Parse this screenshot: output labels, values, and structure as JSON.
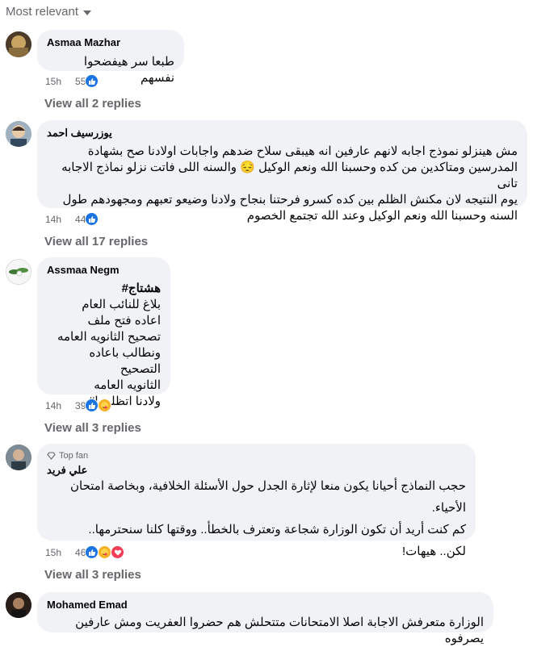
{
  "sort_label": "Most relevant",
  "comments": [
    {
      "author": "Asmaa Mazhar",
      "lines": [
        "طبعا سر هيفضحوا نفسهم"
      ],
      "time": "15h",
      "reactions": "55",
      "view_replies": "View all 2 replies"
    },
    {
      "author": "يوزرسيف احمد",
      "lines": [
        "مش هينزلو نموذج اجابه لانهم عارفين انه هيبقى سلاح ضدهم واجابات اولادنا صح بشهادة",
        "المدرسين ومتاكدين من كده وحسبنا الله ونعم الوكيل 😔 والسنه اللى فاتت نزلو نماذج الاجابه تانى",
        "يوم النتيجه لان مكنش الظلم بين كده كسرو فرحتنا بنجاح ولادنا وضيعو تعبهم ومجهودهم طول",
        "السنه وحسبنا الله ونعم الوكيل وعند الله تجتمع الخصوم"
      ],
      "time": "14h",
      "reactions": "44",
      "view_replies": "View all 17 replies"
    },
    {
      "author": "Assmaa Negm",
      "hashtag": "هشتاج#",
      "lines": [
        "بلاغ للنائب العام",
        "اعاده فتح ملف",
        "تصحيح الثانويه العامه",
        "ونطالب باعاده التصحيح",
        "الثانويه العامه",
        "ولادنا اتظلموا#"
      ],
      "time": "14h",
      "reactions": "39",
      "view_replies": "View all 3 replies"
    },
    {
      "badge": "Top fan",
      "author": "علي فريد",
      "lines": [
        "حجب النماذج أحيانا يكون منعا لإثارة الجدل حول الأسئلة الخلافية، وبخاصة امتحان الأحياء.",
        "كم كنت أريد أن تكون الوزارة شجاعة وتعترف بالخطأ.. ووقتها كلنا سنحترمها..",
        "لكن.. هيهات!"
      ],
      "time": "15h",
      "reactions": "46",
      "view_replies": "View all 3 replies"
    },
    {
      "author": "Mohamed Emad",
      "lines": [
        "الوزارة متعرفش الاجابة اصلا الامتحانات متتحلش هم حضروا العفريت ومش عارفين يصرفوه"
      ]
    }
  ],
  "colors": {
    "bubble": "#f0f2f5",
    "muted": "#65676b",
    "like": "#1b74e4",
    "care": "#f7b125",
    "love": "#f33e58"
  }
}
